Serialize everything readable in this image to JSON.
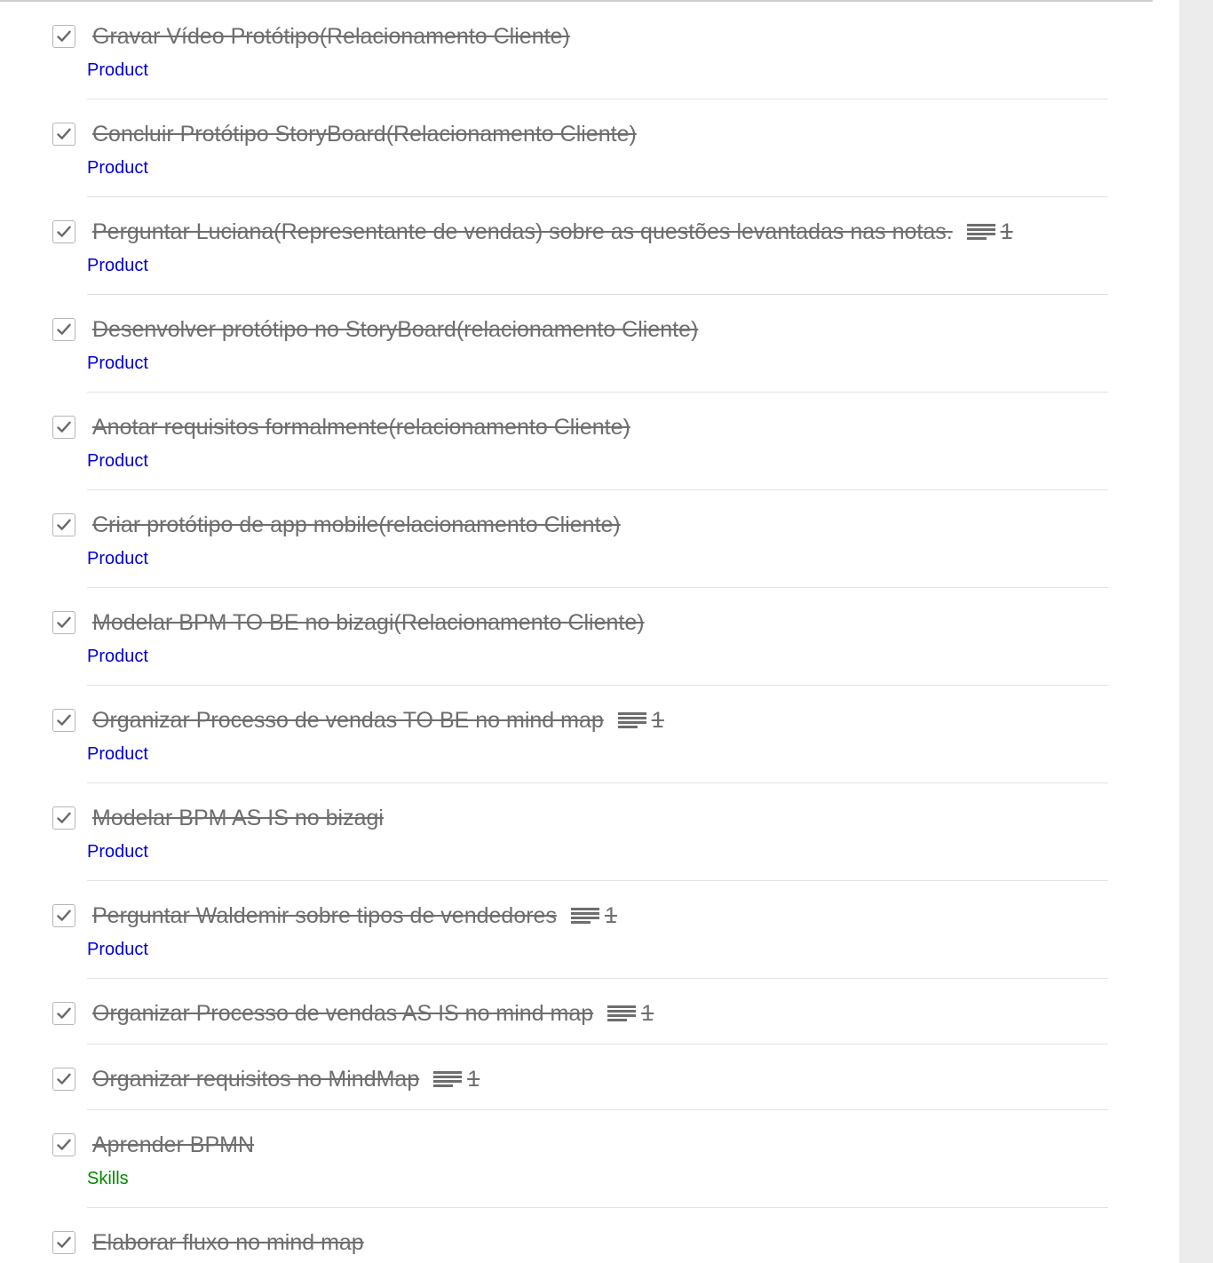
{
  "colors": {
    "product": "#0000dd",
    "skills": "#008a00",
    "completed_text": "#6e6e6e",
    "checkmark": "#6a6a6a"
  },
  "tasks": [
    {
      "title": "Gravar Vídeo Protótipo(Relacionamento Cliente)",
      "project": "Product",
      "project_key": "product",
      "note_count": null
    },
    {
      "title": "Concluir Protótipo StoryBoard(Relacionamento Cliente)",
      "project": "Product",
      "project_key": "product",
      "note_count": null
    },
    {
      "title": "Perguntar Luciana(Representante de vendas) sobre as questões levantadas nas notas.",
      "project": "Product",
      "project_key": "product",
      "note_count": "1"
    },
    {
      "title": "Desenvolver protótipo no StoryBoard(relacionamento Cliente)",
      "project": "Product",
      "project_key": "product",
      "note_count": null
    },
    {
      "title": "Anotar requisitos formalmente(relacionamento Cliente)",
      "project": "Product",
      "project_key": "product",
      "note_count": null
    },
    {
      "title": "Criar protótipo de app mobile(relacionamento Cliente)",
      "project": "Product",
      "project_key": "product",
      "note_count": null
    },
    {
      "title": "Modelar BPM TO BE no bizagi(Relacionamento Cliente)",
      "project": "Product",
      "project_key": "product",
      "note_count": null
    },
    {
      "title": "Organizar Processo de vendas TO BE no mind map",
      "project": "Product",
      "project_key": "product",
      "note_count": "1"
    },
    {
      "title": "Modelar BPM AS IS no bizagi",
      "project": "Product",
      "project_key": "product",
      "note_count": null
    },
    {
      "title": "Perguntar Waldemir sobre tipos de vendedores",
      "project": "Product",
      "project_key": "product",
      "note_count": "1"
    },
    {
      "title": "Organizar Processo de vendas AS IS no mind map",
      "project": null,
      "project_key": null,
      "note_count": "1"
    },
    {
      "title": "Organizar requisitos no MindMap",
      "project": null,
      "project_key": null,
      "note_count": "1"
    },
    {
      "title": "Aprender BPMN",
      "project": "Skills",
      "project_key": "skills",
      "note_count": null
    },
    {
      "title": "Elaborar fluxo no mind map",
      "project": null,
      "project_key": null,
      "note_count": null
    }
  ],
  "icons": {
    "checkbox_mark": "checkmark-icon",
    "note": "note-lines-icon"
  }
}
